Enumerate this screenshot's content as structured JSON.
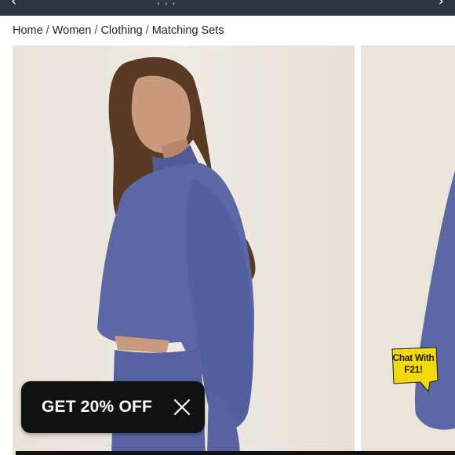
{
  "topbar": {
    "prev_icon": "chevron-left-icon",
    "next_icon": "chevron-right-icon",
    "clipped_text": ", , ,"
  },
  "breadcrumb": {
    "items": [
      "Home",
      "Women",
      "Clothing",
      "Matching Sets"
    ],
    "separator": "/"
  },
  "gallery": {
    "background_color": "#ece7df",
    "garment_color": "#5c67a6"
  },
  "promo": {
    "text": "GET 20% OFF",
    "close_icon": "close-icon",
    "background_color": "#111111"
  },
  "chat": {
    "line1": "Chat With",
    "line2": "F21!",
    "bubble_color": "#f5d90f"
  }
}
